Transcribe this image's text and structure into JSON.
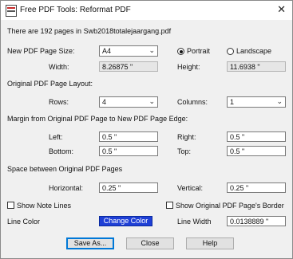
{
  "window": {
    "title": "Free PDF Tools: Reformat PDF",
    "close_glyph": "✕"
  },
  "info": {
    "page_count_text": "There are 192 pages in Swb2018totalejaargang.pdf"
  },
  "page_size": {
    "label": "New PDF Page Size:",
    "selected": "A4",
    "orientation": {
      "portrait_label": "Portrait",
      "landscape_label": "Landscape",
      "selected": "Portrait"
    },
    "width_label": "Width:",
    "width_value": "8.26875 \"",
    "height_label": "Height:",
    "height_value": "11.6938 \""
  },
  "layout": {
    "label": "Original PDF Page Layout:",
    "rows_label": "Rows:",
    "rows_value": "4",
    "columns_label": "Columns:",
    "columns_value": "1"
  },
  "margins": {
    "label": "Margin from Original PDF Page to New PDF Page Edge:",
    "left_label": "Left:",
    "left_value": "0.5 \"",
    "right_label": "Right:",
    "right_value": "0.5 \"",
    "bottom_label": "Bottom:",
    "bottom_value": "0.5 \"",
    "top_label": "Top:",
    "top_value": "0.5 \""
  },
  "spacing": {
    "label": "Space between Original PDF Pages",
    "horizontal_label": "Horizontal:",
    "horizontal_value": "0.25 \"",
    "vertical_label": "Vertical:",
    "vertical_value": "0.25 \""
  },
  "options": {
    "show_note_lines": "Show Note Lines",
    "show_border": "Show Original PDF Page's Border"
  },
  "line": {
    "color_label": "Line Color",
    "change_color_button": "Change Color",
    "color_swatch": "#1e3fd6",
    "width_label": "Line Width",
    "width_value": "0.0138889 \""
  },
  "buttons": {
    "save_as": "Save As...",
    "close": "Close",
    "help": "Help"
  }
}
